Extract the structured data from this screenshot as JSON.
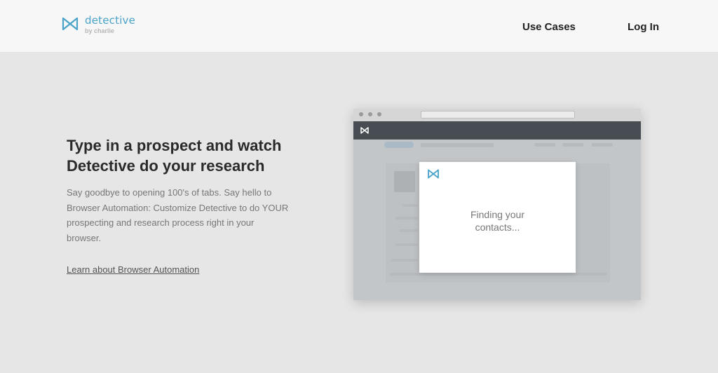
{
  "header": {
    "logo": {
      "name": "detective",
      "sub": "by charlie"
    },
    "nav": [
      {
        "label": "Use Cases"
      },
      {
        "label": "Log In"
      }
    ]
  },
  "hero": {
    "headline_line1": "Type in a prospect and watch",
    "headline_line2": "Detective do your research",
    "body": "Say goodbye to opening 100's of tabs. Say hello to Browser Automation: Customize Detective to do YOUR prospecting and research process right in your browser.",
    "link": "Learn about Browser Automation"
  },
  "illustration": {
    "modal_line1": "Finding your",
    "modal_line2": "contacts..."
  },
  "colors": {
    "brand": "#4aa3c8",
    "appbar": "#474d52",
    "background": "#e6e6e6"
  }
}
